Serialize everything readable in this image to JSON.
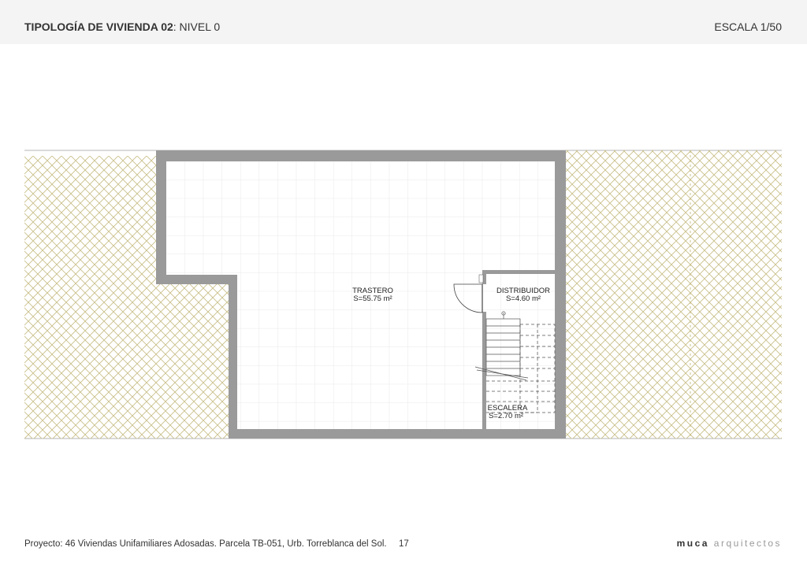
{
  "header": {
    "title_bold": "TIPOLOGÍA DE VIVIENDA 02",
    "title_rest": ": NIVEL 0",
    "scale": "ESCALA 1/50"
  },
  "rooms": {
    "trastero": {
      "name": "TRASTERO",
      "area": "S=55.75 m²"
    },
    "distribuidor": {
      "name": "DISTRIBUIDOR",
      "area": "S=4.60 m²"
    },
    "escalera": {
      "name": "ESCALERA",
      "area": "S=2.70 m²"
    }
  },
  "footer": {
    "project": "Proyecto: 46 Viviendas Unifamiliares Adosadas. Parcela TB-051, Urb. Torreblanca del Sol.",
    "page": "17",
    "brand_bold": "muca",
    "brand_light": "arquitectos"
  },
  "colors": {
    "header_bg": "#f4f4f4",
    "wall": "#9a9a9a",
    "hatch": "#c9c089",
    "grid": "#e3e3e3"
  }
}
